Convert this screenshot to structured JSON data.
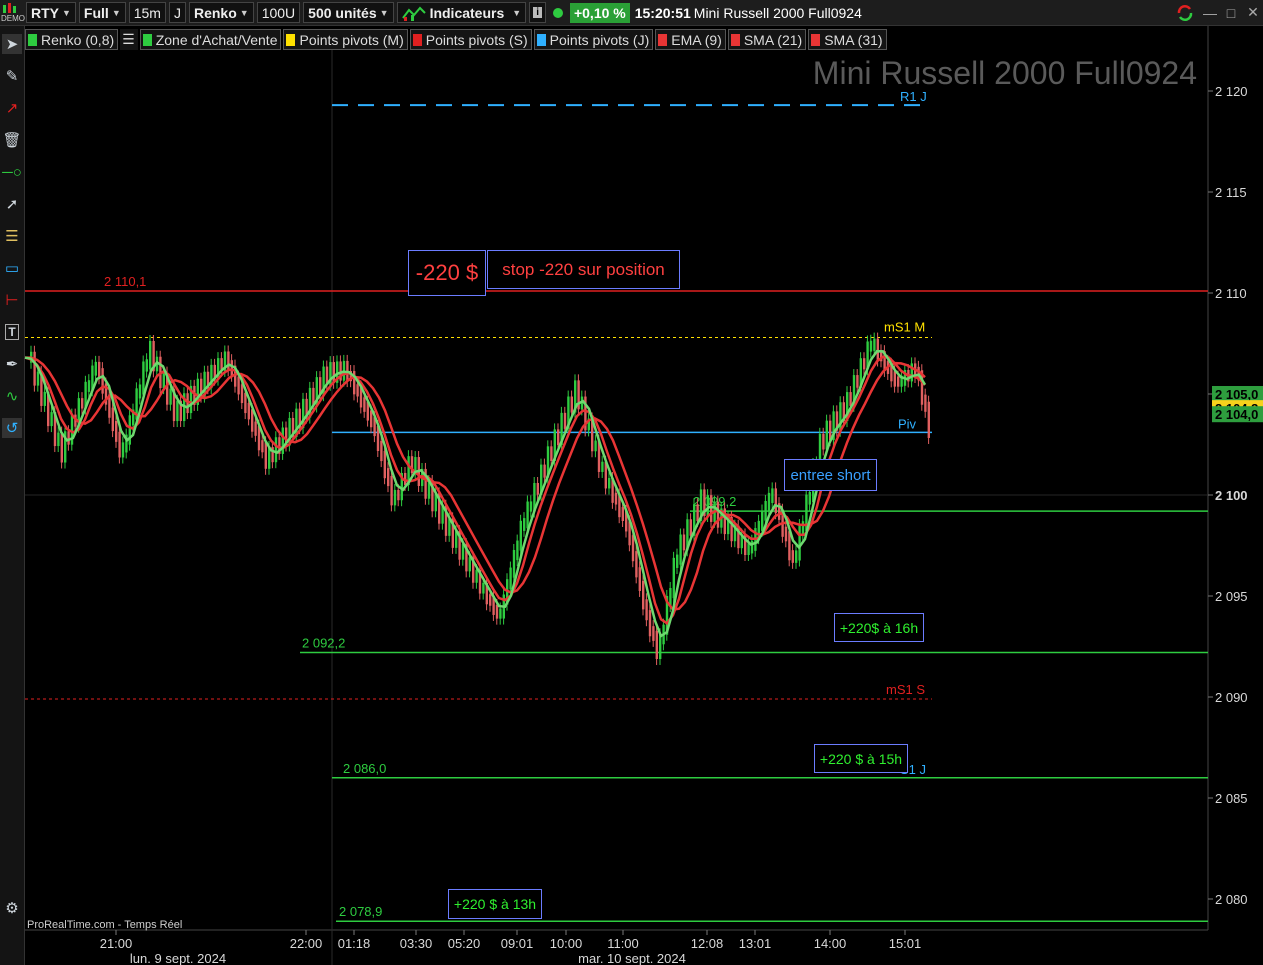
{
  "toolbar": {
    "demo_logo": "DEMO",
    "symbol": "RTY",
    "layout": "Full",
    "timeframe": "15m",
    "period_unit": "J",
    "chart_type": "Renko",
    "box_size": "100U",
    "units": "500 unités",
    "indicators_label": "Indicateurs",
    "change_pct": "+0,10 %",
    "clock": "15:20:51",
    "instrument_title": "Mini Russell 2000 Full0924"
  },
  "indicator_list": [
    {
      "label": "Renko (0,8)",
      "color": "#2ecc40"
    },
    {
      "label": "Zone d'Achat/Vente",
      "color": "#2ecc40"
    },
    {
      "label": "Points pivots (M)",
      "color": "#ffe100"
    },
    {
      "label": "Points pivots (S)",
      "color": "#e02020"
    },
    {
      "label": "Points pivots (J)",
      "color": "#2fb0ff"
    },
    {
      "label": "EMA (9)",
      "color": "#e83535"
    },
    {
      "label": "SMA (21)",
      "color": "#e83535"
    },
    {
      "label": "SMA (31)",
      "color": "#e83535"
    }
  ],
  "watermark": "Mini Russell 2000 Full0924",
  "footer": "ProRealTime.com - Temps Réel",
  "price_labels": [
    "2 120",
    "2 115",
    "2 110",
    "2 105",
    "2 100",
    "2 095",
    "2 090",
    "2 085",
    "2 080"
  ],
  "price_tags": [
    {
      "text": "2 105,0",
      "price": 2105.0,
      "bg": "#2e9e3e"
    },
    {
      "text": "2 104,3",
      "price": 2104.3,
      "bg": "#f6d21c"
    },
    {
      "text": "2 104,0",
      "price": 2104.0,
      "bg": "#2e9e3e"
    }
  ],
  "time_labels": [
    "21:00",
    "22:00",
    "01:18",
    "03:30",
    "05:20",
    "09:01",
    "10:00",
    "11:00",
    "12:08",
    "13:01",
    "14:00",
    "15:01"
  ],
  "date_labels": [
    "lun. 9 sept. 2024",
    "mar. 10 sept. 2024"
  ],
  "levels": {
    "stop": {
      "price": 2110.1,
      "label": "2 110,1",
      "color": "#e02020"
    },
    "r1j": {
      "price": 2119.3,
      "label": "R1 J",
      "color": "#2fb0ff"
    },
    "ms1m": {
      "price": 2107.8,
      "label": "mS1 M",
      "color": "#ffe100"
    },
    "pivot": {
      "price": 2103.1,
      "label": "Piv",
      "color": "#2fb0ff"
    },
    "entry": {
      "price": 2099.2,
      "label": "2 099,2",
      "color": "#2ecc40"
    },
    "tp1": {
      "price": 2092.2,
      "label": "2 092,2",
      "color": "#2ecc40"
    },
    "ms1s": {
      "price": 2089.9,
      "label": "mS1 S",
      "color": "#e02020"
    },
    "tp2": {
      "price": 2086.0,
      "label": "2 086,0",
      "color": "#2ecc40"
    },
    "s1j": {
      "label": "S1 J",
      "color": "#2fb0ff"
    },
    "tp3": {
      "price": 2078.9,
      "label": "2 078,9",
      "color": "#2ecc40"
    }
  },
  "annotations": {
    "loss": "-220 $",
    "stop_note": "stop -220 sur position",
    "entry_note": "entree short",
    "gain_16h": "+220$ à 16h",
    "gain_15h": "+220 $ à 15h",
    "gain_13h": "+220 $ à 13h"
  },
  "chart_data": {
    "type": "renko",
    "ylim": [
      2077,
      2122
    ],
    "brick_size": 1.0,
    "last_price": 2104.3
  }
}
